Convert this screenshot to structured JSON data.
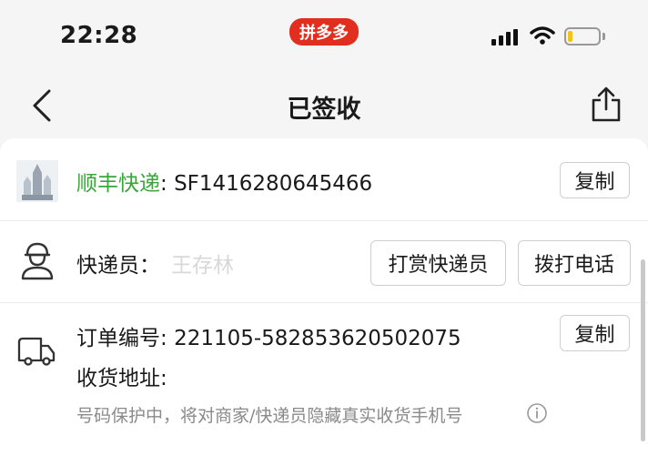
{
  "status_bar": {
    "time": "22:28",
    "app_badge": "拼多多"
  },
  "nav": {
    "title": "已签收"
  },
  "shipment": {
    "carrier_name": "顺丰快递",
    "separator": ": ",
    "tracking_number": "SF1416280645466",
    "copy_label": "复制"
  },
  "courier": {
    "label": "快递员：",
    "name": "王存林",
    "tip_button": "打赏快递员",
    "call_button": "拨打电话"
  },
  "order": {
    "number_label": "订单编号: ",
    "number": "221105-582853620502075",
    "copy_label": "复制",
    "address_label": "收货地址:",
    "privacy_note": "号码保护中，将对商家/快递员隐藏真实收货手机号"
  },
  "colors": {
    "carrier_green": "#3aa63a",
    "badge_red": "#e22e1f"
  }
}
